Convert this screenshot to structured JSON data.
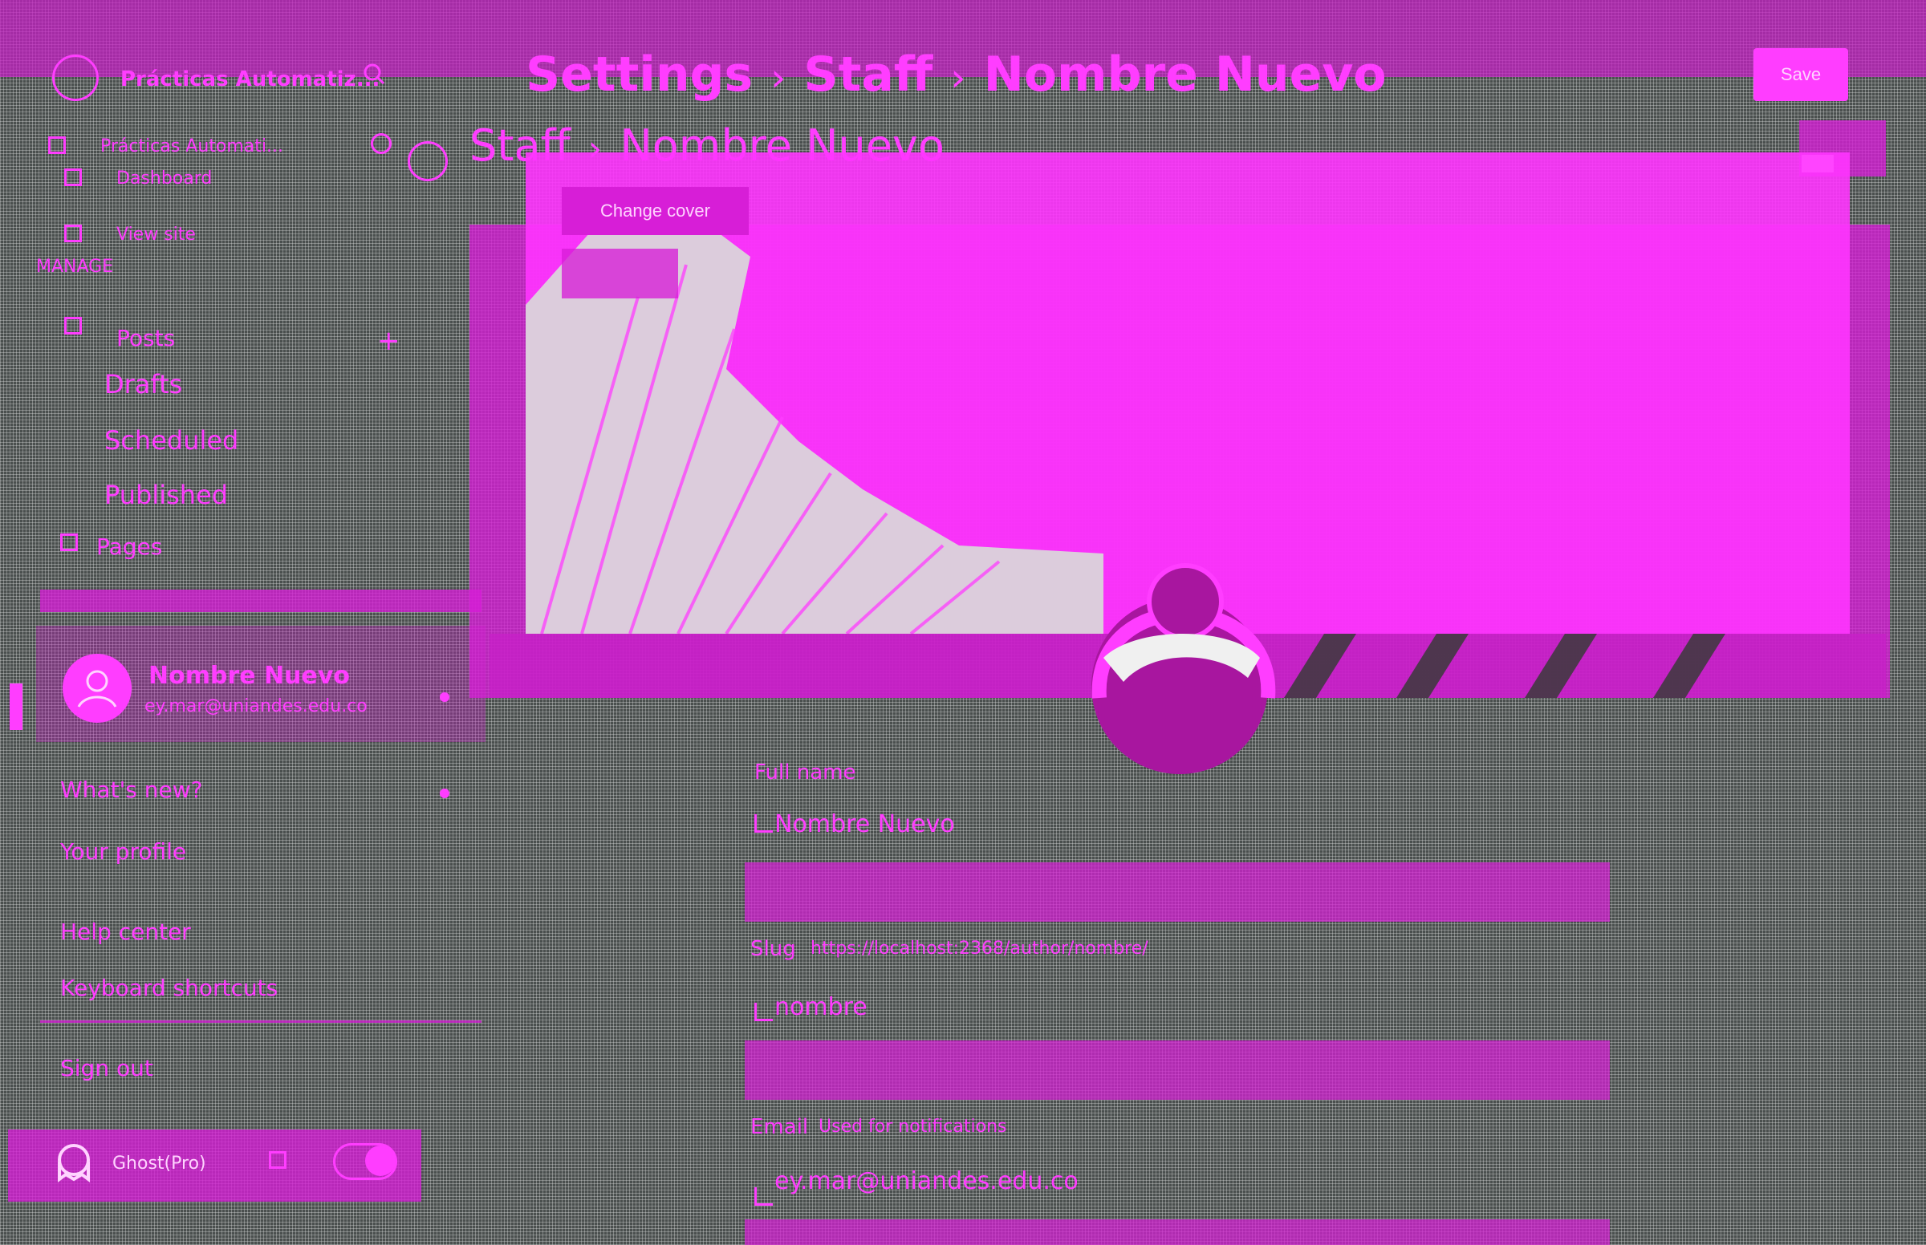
{
  "topbar": {
    "breadcrumb": [
      "Settings",
      "Staff",
      "Nombre Nuevo"
    ],
    "separator": "›",
    "save_label": "Save"
  },
  "sidebar": {
    "site_name": "Prácticas Automatiz...",
    "site_name_2": "Prácticas Automati...",
    "nav": [
      {
        "label": "Dashboard",
        "icon": "dashboard-icon"
      },
      {
        "label": "View site",
        "icon": "view-site-icon"
      }
    ],
    "manage_heading": "MANAGE",
    "posts_label": "Posts",
    "posts_sub": [
      "Drafts",
      "Scheduled",
      "Published"
    ],
    "pages_label": "Pages",
    "user": {
      "name": "Nombre Nuevo",
      "email": "ey.mar@uniandes.edu.co"
    },
    "menu": [
      "What's new?",
      "Your profile",
      "Help center",
      "Keyboard shortcuts",
      "Sign out"
    ],
    "footer_label": "Ghost(Pro)"
  },
  "main": {
    "header": [
      "Staff",
      "Nombre Nuevo"
    ],
    "change_cover_label": "Change cover",
    "fields": {
      "full_name_label": "Full name",
      "full_name_value": "Nombre Nuevo",
      "slug_label": "Slug",
      "slug_helper": "https://localhost:2368/author/nombre/",
      "slug_value": "nombre",
      "email_label": "Email",
      "email_helper": "Used for notifications",
      "email_value": "ey.mar@uniandes.edu.co"
    }
  },
  "colors": {
    "accent": "#ff3dff",
    "band": "#d71ed7",
    "background": "#4a4f4e"
  }
}
